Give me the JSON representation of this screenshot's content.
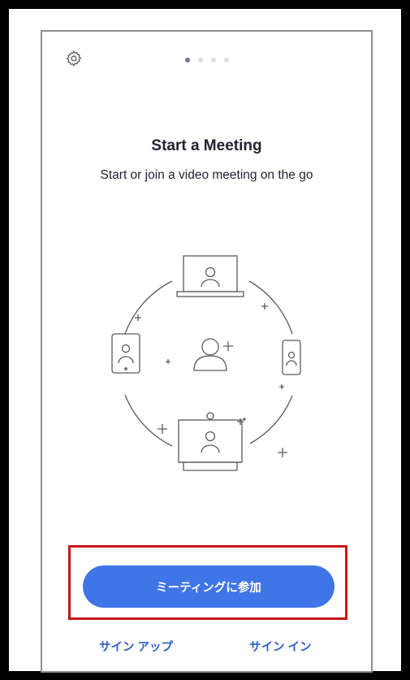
{
  "header": {
    "settings_icon": "gear-icon",
    "page_indicator": {
      "count": 4,
      "active": 1
    }
  },
  "main": {
    "title": "Start a Meeting",
    "subtitle": "Start or join a video meeting on the go",
    "illustration_icon": "devices-around-person-icon"
  },
  "actions": {
    "join_label": "ミーティングに参加",
    "signup_label": "サイン アップ",
    "signin_label": "サイン イン"
  },
  "colors": {
    "accent": "#3f75e6",
    "link": "#2d5fc9",
    "highlight": "#c4161c",
    "title": "#232333"
  }
}
